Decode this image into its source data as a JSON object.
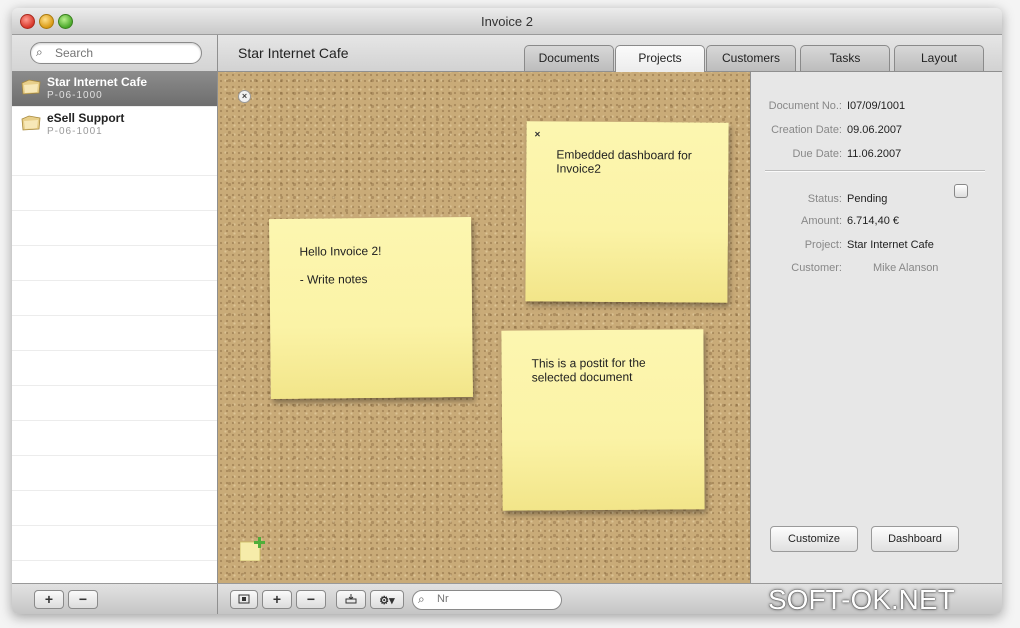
{
  "window": {
    "title": "Invoice 2"
  },
  "sidebar": {
    "search": {
      "placeholder": "Search"
    },
    "items": [
      {
        "name": "Star Internet Cafe",
        "code": "P-06-1000",
        "selected": true
      },
      {
        "name": "eSell Support",
        "code": "P-06-1001",
        "selected": false
      }
    ],
    "bottom": {
      "add_label": "+",
      "remove_label": "−"
    }
  },
  "header": {
    "title": "Star Internet Cafe",
    "tabs": [
      {
        "label": "Documents",
        "active": false
      },
      {
        "label": "Projects",
        "active": true
      },
      {
        "label": "Customers",
        "active": false
      },
      {
        "label": "Tasks",
        "active": false
      },
      {
        "label": "Layout",
        "active": false
      }
    ]
  },
  "board": {
    "notes": [
      {
        "text": "Hello Invoice 2!\n\n- Write notes"
      },
      {
        "text": "Embedded dashboard for Invoice2"
      },
      {
        "text": "This is a postit for the selected document"
      }
    ]
  },
  "details": {
    "document_no": {
      "label": "Document No.:",
      "value": "I07/09/1001"
    },
    "creation_date": {
      "label": "Creation Date:",
      "value": "09.06.2007"
    },
    "due_date": {
      "label": "Due Date:",
      "value": "11.06.2007"
    },
    "status": {
      "label": "Status:",
      "value": "Pending"
    },
    "amount": {
      "label": "Amount:",
      "value": "6.714,40 €"
    },
    "project": {
      "label": "Project:",
      "value": "Star Internet Cafe"
    },
    "customer": {
      "label": "Customer:",
      "value": "Mike Alanson"
    },
    "customize_label": "Customize",
    "dashboard_label": "Dashboard"
  },
  "main_bottom": {
    "add_label": "+",
    "remove_label": "−",
    "search_placeholder": "Nr"
  },
  "watermark": "SOFT-OK.NET",
  "colors": {
    "cork": "#c9ab78",
    "postit": "#fbf3a6",
    "selection": "#7d7d7d"
  }
}
